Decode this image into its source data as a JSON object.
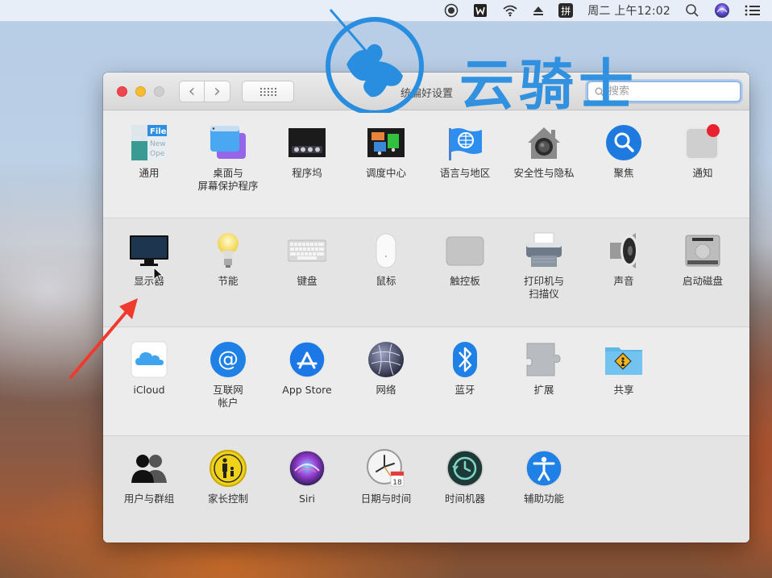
{
  "menubar": {
    "icons": [
      "screen-record-icon",
      "wps-icon",
      "wifi-icon",
      "eject-icon",
      "pinyin-input-icon"
    ],
    "input_method_label": "拼",
    "clock": "周二 上午12:02",
    "right_icons": [
      "spotlight-search-icon",
      "siri-icon",
      "notification-center-icon"
    ]
  },
  "window": {
    "title": "系统偏好设置",
    "visible_title_fragment": "统偏好设置",
    "search_placeholder": "搜索",
    "nav": {
      "back": "‹",
      "forward": "›"
    }
  },
  "watermark": {
    "text": "云骑士"
  },
  "sections": [
    {
      "items": [
        {
          "id": "general",
          "label": "通用",
          "icon": "general-icon"
        },
        {
          "id": "desktop",
          "label": "桌面与\n屏幕保护程序",
          "icon": "desktop-screensaver-icon"
        },
        {
          "id": "dock",
          "label": "程序坞",
          "icon": "dock-icon"
        },
        {
          "id": "mission-control",
          "label": "调度中心",
          "icon": "mission-control-icon"
        },
        {
          "id": "language",
          "label": "语言与地区",
          "icon": "language-region-icon"
        },
        {
          "id": "security",
          "label": "安全性与隐私",
          "icon": "security-privacy-icon"
        },
        {
          "id": "spotlight",
          "label": "聚焦",
          "icon": "spotlight-icon"
        },
        {
          "id": "notifications",
          "label": "通知",
          "icon": "notifications-icon"
        }
      ]
    },
    {
      "items": [
        {
          "id": "displays",
          "label": "显示器",
          "icon": "displays-icon"
        },
        {
          "id": "energy",
          "label": "节能",
          "icon": "energy-saver-icon"
        },
        {
          "id": "keyboard",
          "label": "键盘",
          "icon": "keyboard-icon"
        },
        {
          "id": "mouse",
          "label": "鼠标",
          "icon": "mouse-icon"
        },
        {
          "id": "trackpad",
          "label": "触控板",
          "icon": "trackpad-icon"
        },
        {
          "id": "printers",
          "label": "打印机与\n扫描仪",
          "icon": "printer-scanner-icon"
        },
        {
          "id": "sound",
          "label": "声音",
          "icon": "sound-icon"
        },
        {
          "id": "startup-disk",
          "label": "启动磁盘",
          "icon": "startup-disk-icon"
        }
      ]
    },
    {
      "items": [
        {
          "id": "icloud",
          "label": "iCloud",
          "icon": "icloud-icon"
        },
        {
          "id": "internet-accounts",
          "label": "互联网\n帐户",
          "icon": "internet-accounts-icon"
        },
        {
          "id": "app-store",
          "label": "App Store",
          "icon": "app-store-icon"
        },
        {
          "id": "network",
          "label": "网络",
          "icon": "network-icon"
        },
        {
          "id": "bluetooth",
          "label": "蓝牙",
          "icon": "bluetooth-icon"
        },
        {
          "id": "extensions",
          "label": "扩展",
          "icon": "extensions-icon"
        },
        {
          "id": "sharing",
          "label": "共享",
          "icon": "sharing-icon"
        }
      ]
    },
    {
      "items": [
        {
          "id": "users",
          "label": "用户与群组",
          "icon": "users-groups-icon"
        },
        {
          "id": "parental",
          "label": "家长控制",
          "icon": "parental-controls-icon"
        },
        {
          "id": "siri",
          "label": "Siri",
          "icon": "siri-icon"
        },
        {
          "id": "date-time",
          "label": "日期与时间",
          "icon": "date-time-icon"
        },
        {
          "id": "time-machine",
          "label": "时间机器",
          "icon": "time-machine-icon"
        },
        {
          "id": "accessibility",
          "label": "辅助功能",
          "icon": "accessibility-icon"
        }
      ]
    }
  ],
  "date_time_icon_day": "18",
  "colors": {
    "close": "#f2464f",
    "minimize": "#f7bc2f",
    "zoom_disabled": "#cfcfcf",
    "annotation_arrow": "#f03a2e",
    "watermark": "#2a8ee0"
  }
}
